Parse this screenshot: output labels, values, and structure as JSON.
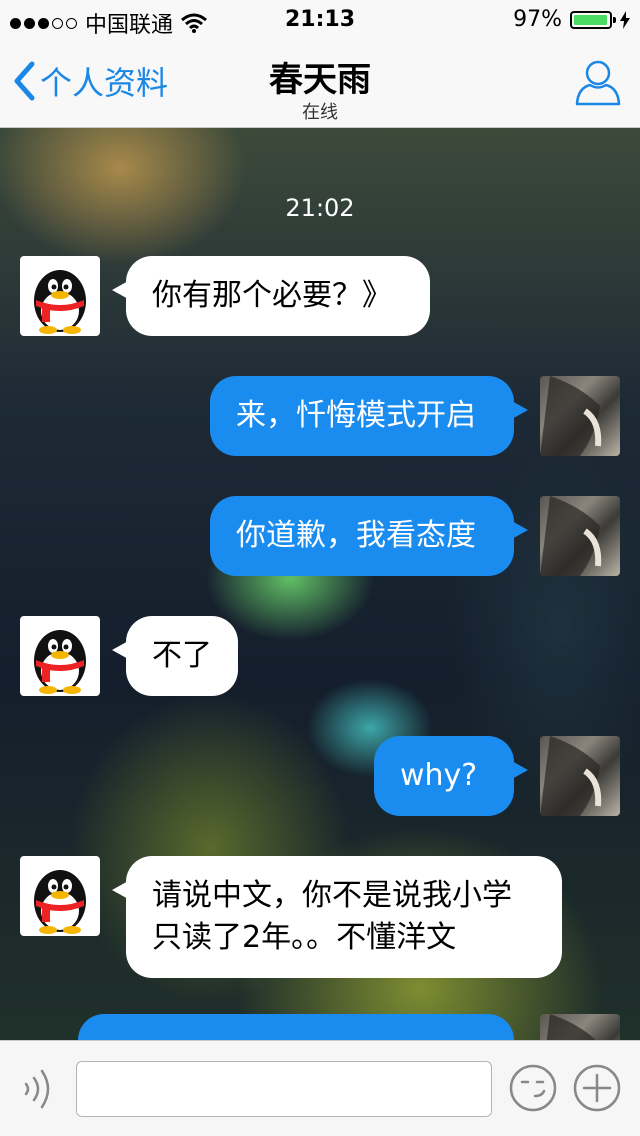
{
  "status_bar": {
    "signal_dots_filled": 3,
    "signal_dots_total": 5,
    "carrier": "中国联通",
    "time": "21:13",
    "battery_percent": "97%",
    "battery_level": 0.97,
    "battery_color": "#4cd964"
  },
  "nav": {
    "back_label": "个人资料",
    "title": "春天雨",
    "subtitle": "在线",
    "accent_color": "#1a87e6"
  },
  "chat": {
    "timestamp": "21:02",
    "messages": [
      {
        "direction": "in",
        "text": "你有那个必要？》"
      },
      {
        "direction": "out",
        "text": "来，忏悔模式开启"
      },
      {
        "direction": "out",
        "text": "你道歉，我看态度"
      },
      {
        "direction": "in",
        "text": "不了"
      },
      {
        "direction": "out",
        "text": "why?"
      },
      {
        "direction": "in",
        "text": "请说中文，你不是说我小学只读了2年。。不懂洋文"
      },
      {
        "direction": "out",
        "text": ""
      }
    ],
    "outgoing_bubble_color": "#1a8cf0",
    "incoming_bubble_color": "#ffffff"
  },
  "input_bar": {
    "input_value": "",
    "voice_icon": "voice-wave-icon",
    "emoji_icon": "smiley-wink-icon",
    "plus_icon": "plus-circle-icon"
  }
}
